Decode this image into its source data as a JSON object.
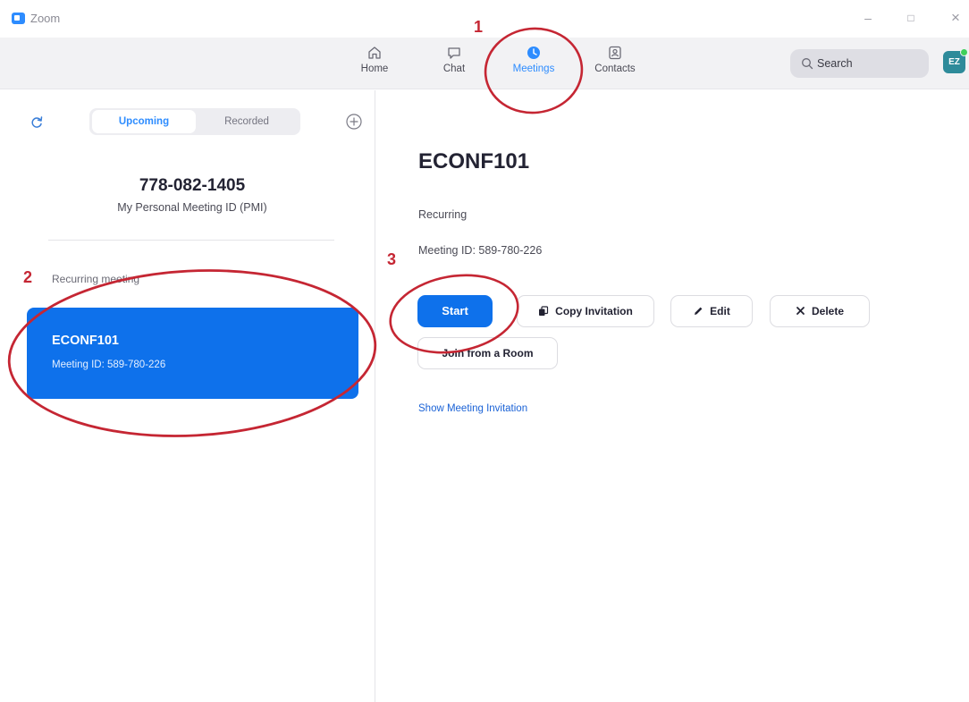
{
  "window": {
    "title": "Zoom",
    "controls": {
      "minimize": "–",
      "maximize": "□",
      "close": "×"
    }
  },
  "nav": {
    "items": [
      {
        "label": "Home",
        "icon": "home-icon",
        "active": false
      },
      {
        "label": "Chat",
        "icon": "chat-icon",
        "active": false
      },
      {
        "label": "Meetings",
        "icon": "clock-icon",
        "active": true
      },
      {
        "label": "Contacts",
        "icon": "contacts-icon",
        "active": false
      }
    ],
    "search_placeholder": "Search",
    "avatar_initials": "EZ",
    "avatar_status_color": "#3ecf5a"
  },
  "meetings_list": {
    "tabs": [
      {
        "label": "Upcoming",
        "selected": true
      },
      {
        "label": "Recorded",
        "selected": false
      }
    ],
    "pmi": {
      "number": "778-082-1405",
      "label": "My Personal Meeting ID (PMI)"
    },
    "section_label": "Recurring meeting",
    "items": [
      {
        "title": "ECONF101",
        "subtitle": "Meeting ID: 589-780-226",
        "selected": true
      }
    ]
  },
  "meeting_detail": {
    "topic": "ECONF101",
    "recurrence": "Recurring",
    "meeting_id": "Meeting ID: 589-780-226",
    "buttons": {
      "start": "Start",
      "copy_invitation": "Copy Invitation",
      "edit": "Edit",
      "delete": "Delete",
      "join_room": "Join from a Room"
    },
    "show_invitation": "Show Meeting Invitation"
  },
  "annotations": {
    "step_1": "1",
    "step_2": "2",
    "step_3": "3",
    "color": "#c52633"
  },
  "colors": {
    "accent": "#0e71eb",
    "nav_active": "#2d8cff",
    "link": "#1a62d6"
  }
}
